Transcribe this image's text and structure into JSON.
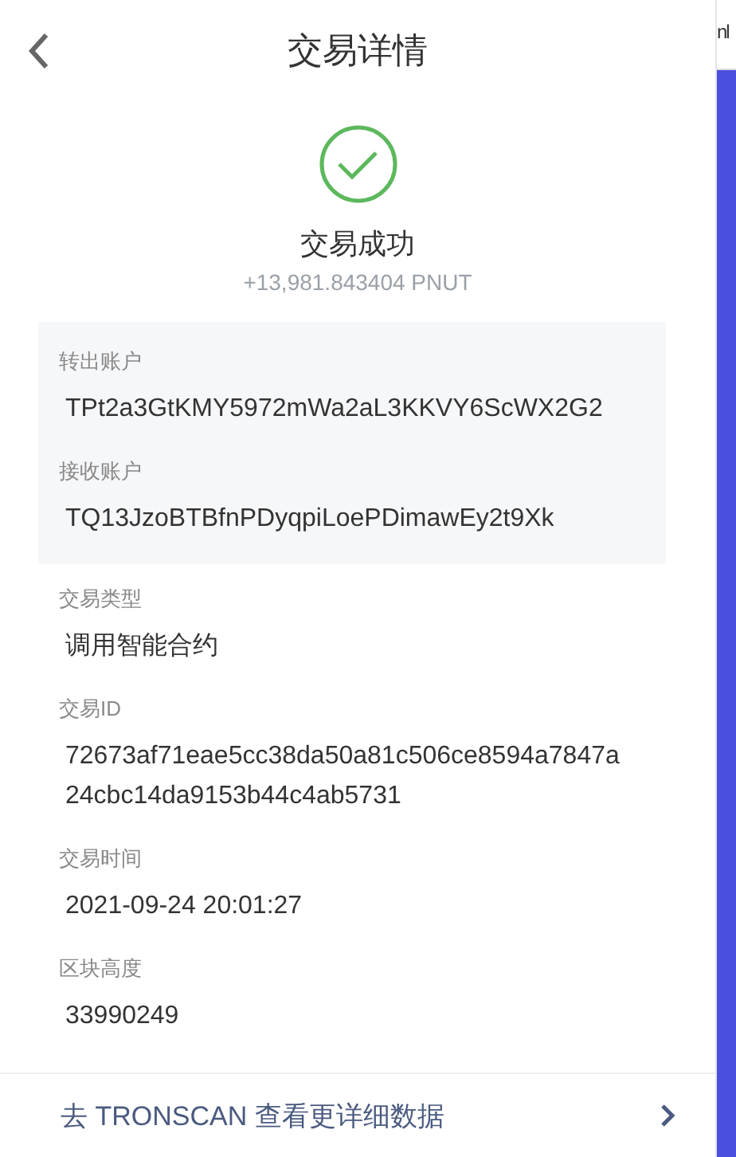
{
  "header": {
    "title": "交易详情"
  },
  "status": {
    "kind": "success",
    "text": "交易成功",
    "amount": "+13,981.843404 PNUT"
  },
  "accounts": [
    {
      "label": "转出账户",
      "value": "TPt2a3GtKMY5972mWa2aL3KKVY6ScWX2G2"
    },
    {
      "label": "接收账户",
      "value": "TQ13JzoBTBfnPDyqpiLoePDimawEy2t9Xk"
    }
  ],
  "details": [
    {
      "label": "交易类型",
      "value": "调用智能合约"
    },
    {
      "label": "交易ID",
      "value": "72673af71eae5cc38da50a81c506ce8594a7847a24cbc14da9153b44c4ab5731"
    },
    {
      "label": "交易时间",
      "value": "2021-09-24 20:01:27"
    },
    {
      "label": "区块高度",
      "value": "33990249"
    }
  ],
  "footer_link": {
    "text": "去 TRONSCAN 查看更详细数据"
  },
  "side_panel": {
    "text": "nl"
  }
}
